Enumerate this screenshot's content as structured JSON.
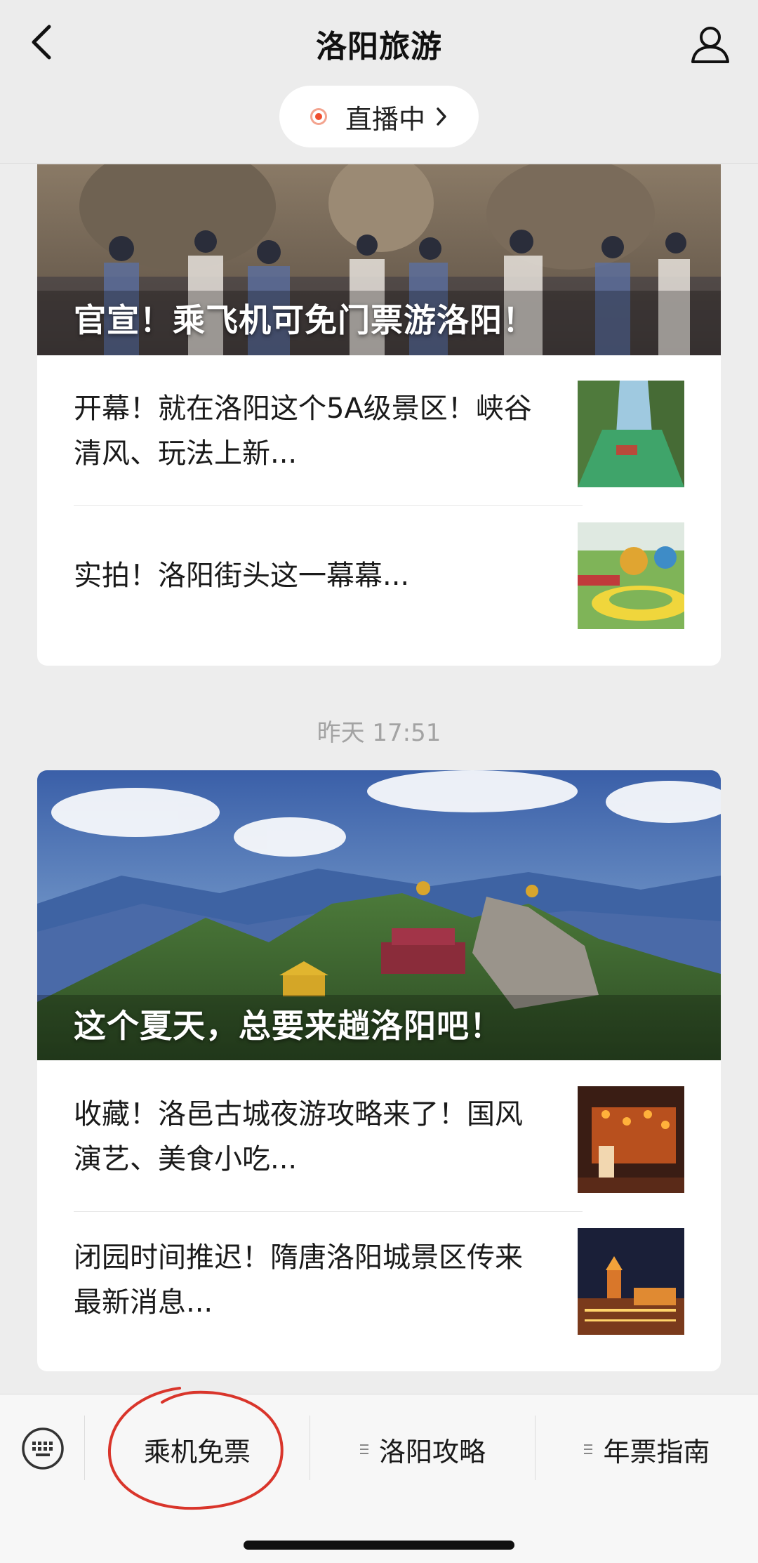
{
  "header": {
    "title": "洛阳旅游",
    "live_label": "直播中"
  },
  "articles_top": {
    "hero_caption": "官宣！乘飞机可免门票游洛阳！",
    "items": [
      {
        "title": "开幕！就在洛阳这个5A级景区！峡谷清风、玩法上新..."
      },
      {
        "title": "实拍！洛阳街头这一幕幕..."
      }
    ]
  },
  "timestamp": "昨天 17:51",
  "articles_bottom": {
    "hero_caption": "这个夏天，总要来趟洛阳吧！",
    "items": [
      {
        "title": "收藏！洛邑古城夜游攻略来了！国风演艺、美食小吃..."
      },
      {
        "title": "闭园时间推迟！隋唐洛阳城景区传来最新消息..."
      }
    ]
  },
  "bottom_menu": {
    "items": [
      {
        "label": "乘机免票"
      },
      {
        "label": "洛阳攻略"
      },
      {
        "label": "年票指南"
      }
    ]
  },
  "icons": [
    "back-icon",
    "profile-icon",
    "live-dot-icon",
    "chevron-right-icon",
    "keyboard-icon",
    "menu-lines-icon"
  ],
  "colors": {
    "live_red": "#ef4f2f",
    "background": "#ededed",
    "annotation_red": "#d9352b"
  }
}
